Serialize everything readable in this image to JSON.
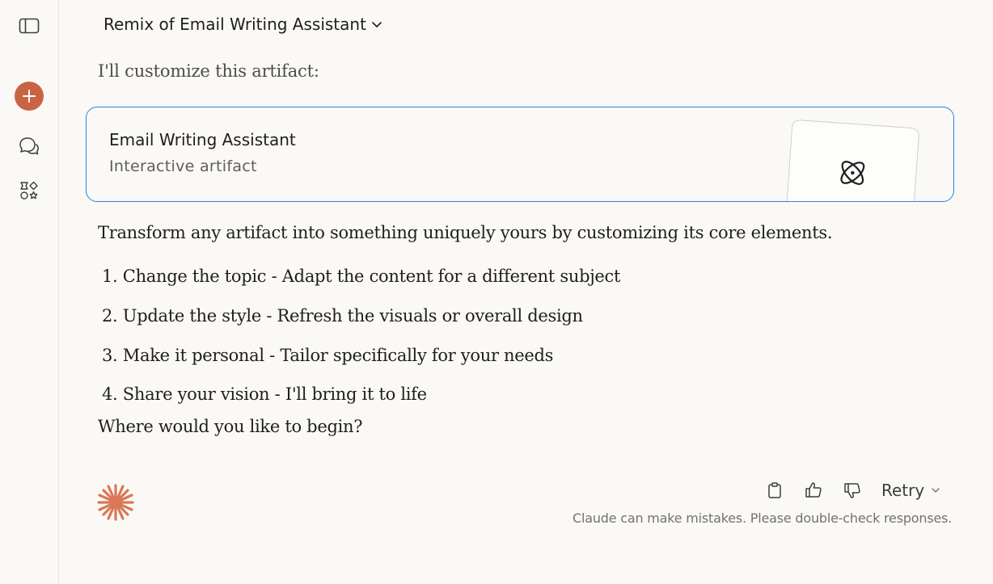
{
  "sidebar": {
    "toggle_icon": "sidebar-toggle-icon",
    "new_chat_icon": "plus-icon",
    "chats_icon": "chat-bubbles-icon",
    "projects_icon": "shapes-icon",
    "accent_color": "#c96442"
  },
  "header": {
    "title": "Remix of Email Writing Assistant"
  },
  "message": {
    "intro": "I'll customize this artifact:",
    "artifact": {
      "title": "Email Writing Assistant",
      "subtitle": "Interactive artifact",
      "icon": "atom-icon"
    },
    "description": "Transform any artifact into something uniquely yours by customizing its core elements.",
    "items": [
      "1. Change the topic - Adapt the content for a different subject",
      "2. Update the style - Refresh the visuals or overall design",
      "3. Make it personal - Tailor specifically for your needs",
      "4. Share your vision - I'll bring it to life"
    ],
    "closing": "Where would you like to begin?"
  },
  "actions": {
    "copy_icon": "clipboard-icon",
    "upvote_icon": "thumbs-up-icon",
    "downvote_icon": "thumbs-down-icon",
    "retry_label": "Retry"
  },
  "footer": {
    "disclaimer": "Claude can make mistakes. Please double-check responses."
  }
}
